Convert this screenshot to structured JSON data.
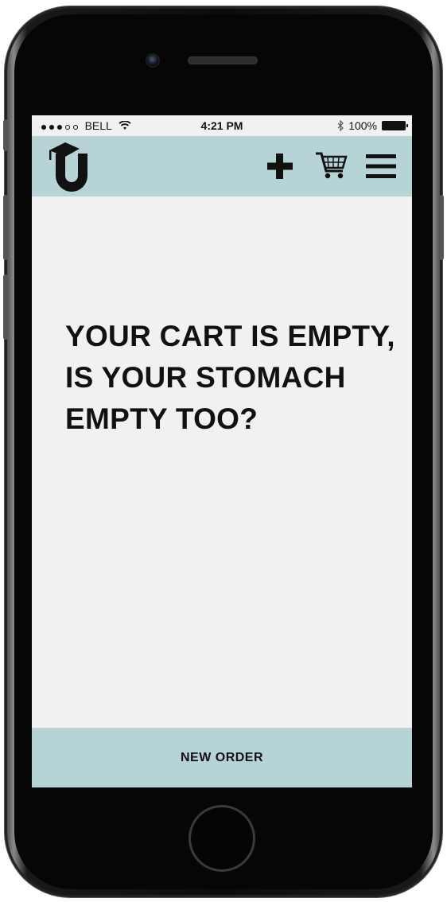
{
  "statusbar": {
    "signal_icon": "signal-dots-icon",
    "carrier": "BELL",
    "wifi_icon": "wifi-icon",
    "time": "4:21 PM",
    "bluetooth_icon": "bluetooth-icon",
    "battery": "100%",
    "battery_icon": "battery-icon"
  },
  "header": {
    "logo_icon": "graduation-cap-u-logo",
    "actions": [
      "plus-icon",
      "cart-icon",
      "menu-icon"
    ],
    "background": "#b6d3d5"
  },
  "main": {
    "message_line1": "YOUR CART IS EMPTY,",
    "message_line2": "IS YOUR STOMACH",
    "message_line3": "EMPTY TOO?",
    "background": "#f1f1f1"
  },
  "footer": {
    "new_order_label": "NEW ORDER",
    "background": "#b6d3d5"
  }
}
